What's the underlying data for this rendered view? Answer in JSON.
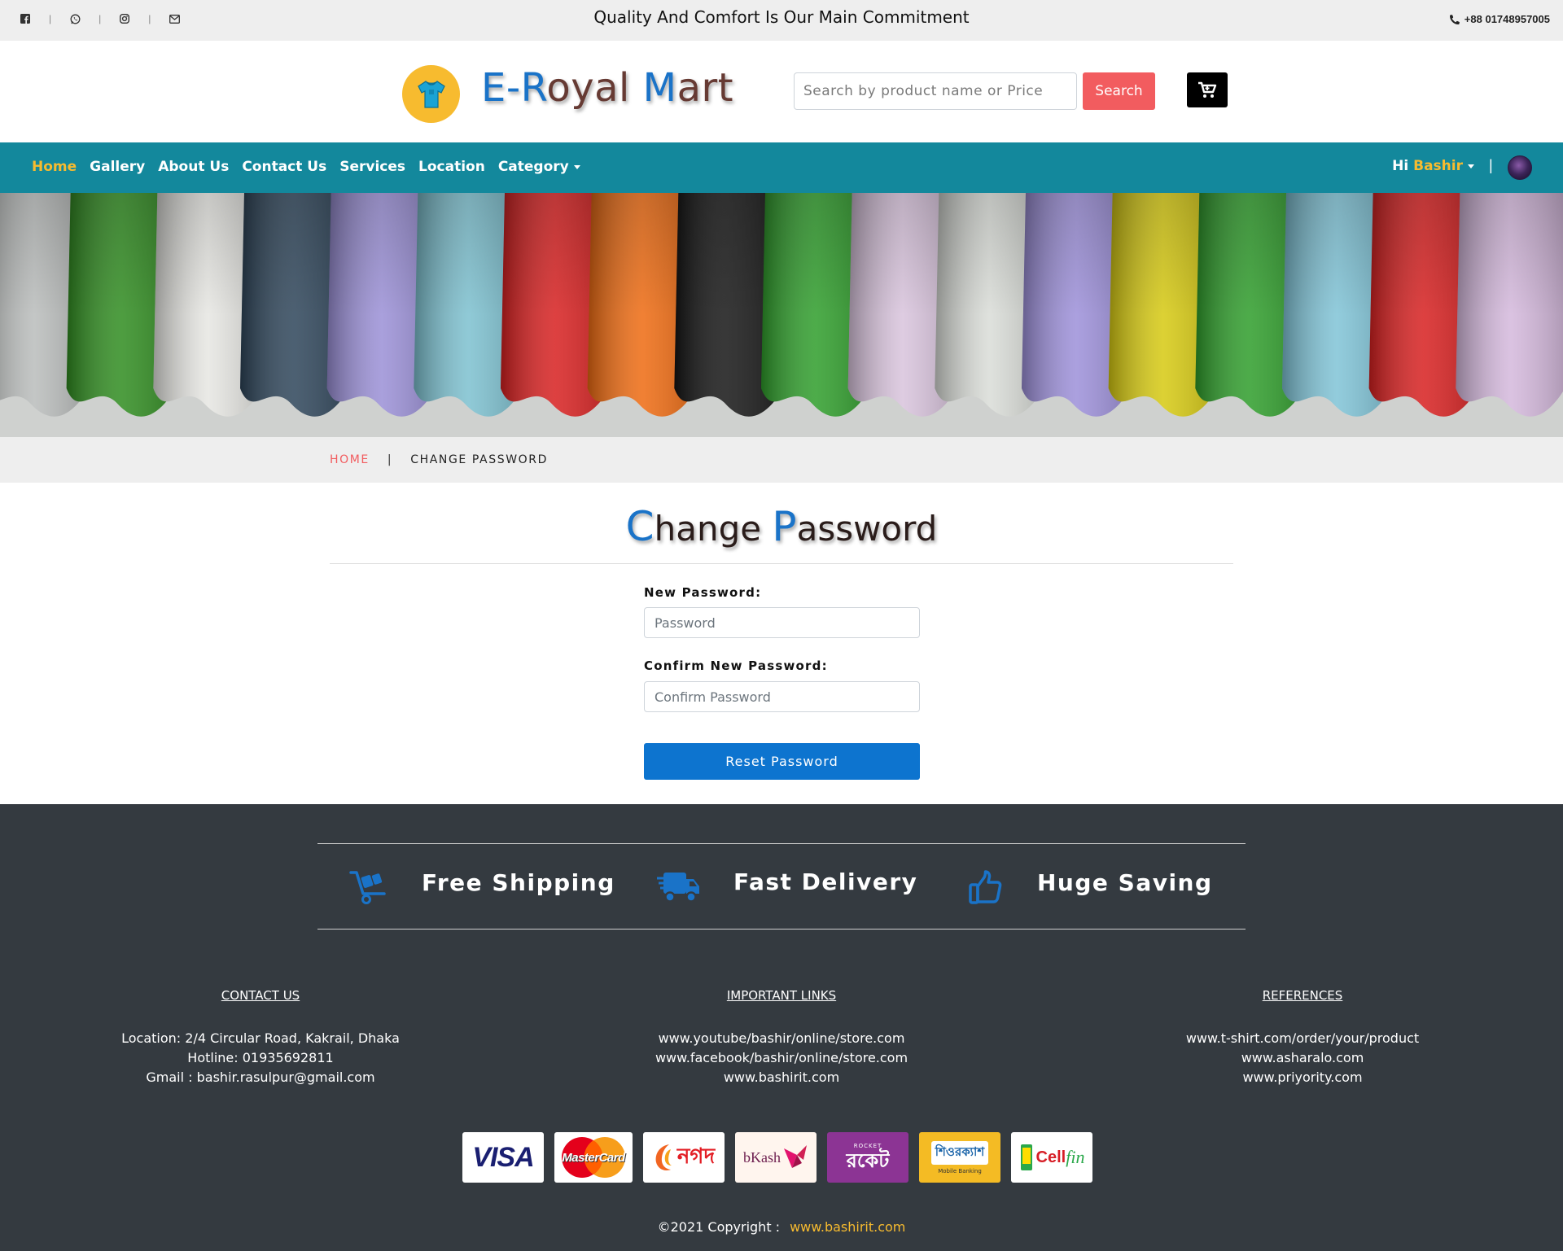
{
  "topbar": {
    "tagline": "Quality And Comfort Is Our Main Commitment",
    "phone": "+88 01748957005",
    "social_icons": [
      "facebook-icon",
      "whatsapp-icon",
      "instagram-icon",
      "mail-icon"
    ],
    "separator": "|"
  },
  "header": {
    "brand_initial": "E-",
    "brand_r": "R",
    "brand_rest1": "oyal ",
    "brand_m": "M",
    "brand_rest2": "art",
    "search_placeholder": "Search by product name or Price",
    "search_label": "Search"
  },
  "nav": {
    "items": [
      {
        "label": "Home",
        "active": true
      },
      {
        "label": "Gallery"
      },
      {
        "label": "About Us"
      },
      {
        "label": "Contact Us"
      },
      {
        "label": "Services"
      },
      {
        "label": "Location"
      },
      {
        "label": "Category"
      }
    ],
    "greeting": "Hi",
    "user_name": "Bashir",
    "divider": "|"
  },
  "breadcrumb": {
    "home": "HOME",
    "separator": "|",
    "current": "CHANGE PASSWORD"
  },
  "form": {
    "title_c": "C",
    "title_rest1": "hange ",
    "title_p": "P",
    "title_rest2": "assword",
    "new_password_label": "New Password:",
    "new_password_placeholder": "Password",
    "confirm_password_label": "Confirm New Password:",
    "confirm_password_placeholder": "Confirm Password",
    "submit_label": "Reset Password"
  },
  "features": [
    {
      "icon": "cart-dolly-icon",
      "title": "Free Shipping"
    },
    {
      "icon": "truck-icon",
      "title": "Fast Delivery"
    },
    {
      "icon": "thumbs-up-icon",
      "title": "Huge Saving"
    }
  ],
  "footer": {
    "contact": {
      "heading": "CONTACT US",
      "lines": [
        "Location: 2/4 Circular Road, Kakrail, Dhaka",
        "Hotline: 01935692811",
        "Gmail : bashir.rasulpur@gmail.com"
      ]
    },
    "links": {
      "heading": "IMPORTANT LINKS",
      "lines": [
        "www.youtube/bashir/online/store.com",
        "www.facebook/bashir/online/store.com",
        "www.bashirit.com"
      ]
    },
    "references": {
      "heading": "REFERENCES",
      "lines": [
        "www.t-shirt.com/order/your/product",
        "www.asharalo.com",
        "www.priyority.com"
      ]
    },
    "payments": {
      "visa": "VISA",
      "mastercard": "MasterCard",
      "nagad": "নগদ",
      "bkash": "bKash",
      "rocket": "রকেট",
      "rocket_small": "ROCKET",
      "surecash": "শিওরক্যাশ",
      "surecash_small": "Mobile Banking",
      "cellfin_cell": "Cell",
      "cellfin_fin": "fin"
    },
    "copyright_text": "©2021 Copyright :",
    "copyright_link": "www.bashirit.com"
  },
  "colors": {
    "brand_blue": "#1a73c8",
    "nav_teal": "#13889c",
    "accent_yellow": "#f7bb2f",
    "search_red": "#f25c5f",
    "button_blue": "#0d74cf",
    "footer_bg": "#343a40"
  }
}
